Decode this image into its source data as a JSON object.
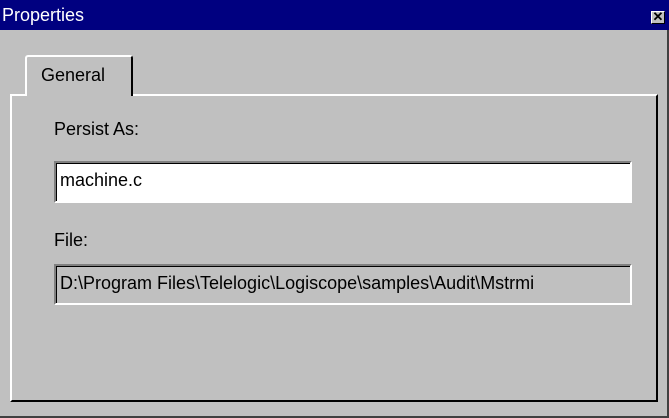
{
  "window": {
    "title": "Properties",
    "close_glyph": "✕"
  },
  "tabs": [
    {
      "label": "General",
      "selected": true
    }
  ],
  "fields": {
    "persist_as": {
      "label": "Persist As:",
      "value": "machine.c"
    },
    "file": {
      "label": "File:",
      "value": "D:\\Program Files\\Telelogic\\Logiscope\\samples\\Audit\\Mstrmi"
    }
  },
  "colors": {
    "titlebar": "#000080",
    "face": "#c0c0c0"
  }
}
